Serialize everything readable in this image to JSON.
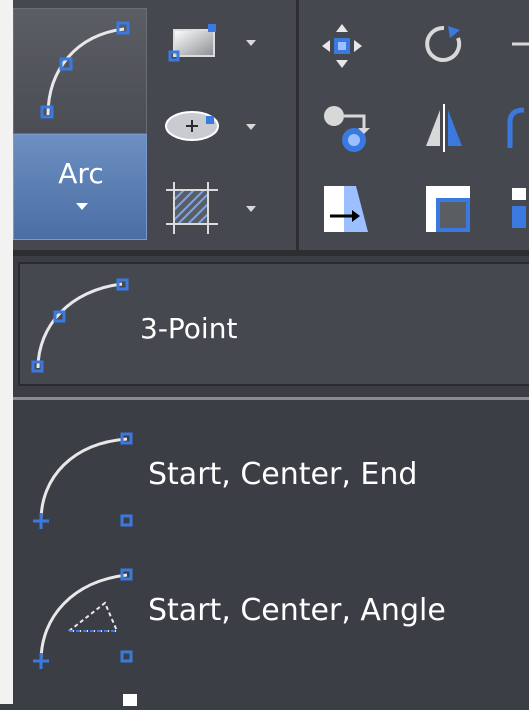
{
  "ribbon": {
    "arc_button": {
      "label": "Arc",
      "icon": "arc-3point-icon"
    },
    "draw_tools": [
      {
        "icon": "rectangle-icon",
        "has_dropdown": true
      },
      {
        "icon": "ellipse-icon",
        "has_dropdown": true
      },
      {
        "icon": "hatch-icon",
        "has_dropdown": true
      }
    ],
    "modify_tools": [
      {
        "icon": "move-icon"
      },
      {
        "icon": "rotate-icon"
      },
      {
        "icon": "copy-icon"
      },
      {
        "icon": "mirror-icon"
      },
      {
        "icon": "stretch-icon"
      },
      {
        "icon": "scale-icon"
      }
    ]
  },
  "dropdown": {
    "items": [
      {
        "label": "3-Point",
        "icon": "arc-3point-icon"
      },
      {
        "label": "Start, Center, End",
        "icon": "arc-start-center-end-icon"
      },
      {
        "label": "Start, Center, Angle",
        "icon": "arc-start-center-angle-icon"
      }
    ]
  },
  "colors": {
    "accent_blue": "#4a6fa5",
    "panel_dark": "#3b3e44",
    "grip_blue": "#3a7ae0"
  }
}
